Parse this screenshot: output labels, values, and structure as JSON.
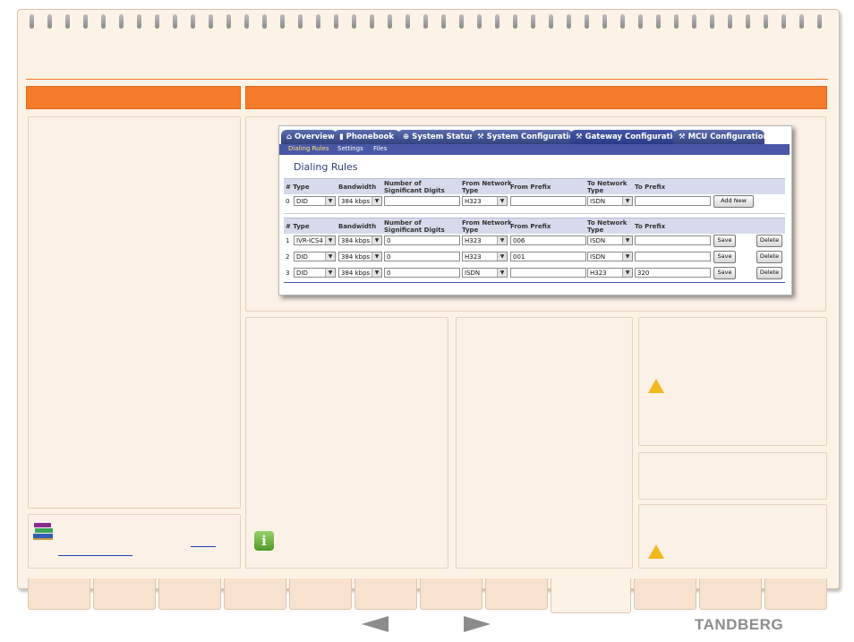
{
  "screenshot": {
    "tabs": [
      {
        "label": "Overview",
        "icon": "home-icon"
      },
      {
        "label": "Phonebook",
        "icon": "book-icon"
      },
      {
        "label": "System Status",
        "icon": "status-icon"
      },
      {
        "label": "System Configuration",
        "icon": "wrench-icon"
      },
      {
        "label": "Gateway Configuration",
        "icon": "wrench-icon"
      },
      {
        "label": "MCU Configuration",
        "icon": "wrench-icon"
      }
    ],
    "subtabs": [
      "Dialing Rules",
      "Settings",
      "Files"
    ],
    "title": "Dialing Rules",
    "headers": {
      "num_type": "# Type",
      "bandwidth": "Bandwidth",
      "sig_digits": "Number of Significant Digits",
      "from_net": "From Network Type",
      "from_prefix": "From Prefix",
      "to_net": "To Network Type",
      "to_prefix": "To Prefix"
    },
    "new_row": {
      "num": "0",
      "type": "DID",
      "bandwidth": "384 kbps",
      "digits": "",
      "from_net": "H323",
      "from_prefix": "",
      "to_net": "ISDN",
      "to_prefix": "",
      "button": "Add New"
    },
    "rows": [
      {
        "num": "1",
        "type": "IVR-ICS4",
        "bandwidth": "384 kbps",
        "digits": "0",
        "from_net": "H323",
        "from_prefix": "006",
        "to_net": "ISDN",
        "to_prefix": "",
        "save": "Save",
        "delete": "Delete"
      },
      {
        "num": "2",
        "type": "DID",
        "bandwidth": "384 kbps",
        "digits": "0",
        "from_net": "H323",
        "from_prefix": "001",
        "to_net": "ISDN",
        "to_prefix": "",
        "save": "Save",
        "delete": "Delete"
      },
      {
        "num": "3",
        "type": "DID",
        "bandwidth": "384 kbps",
        "digits": "0",
        "from_net": "ISDN",
        "from_prefix": "",
        "to_net": "H323",
        "to_prefix": "320",
        "save": "Save",
        "delete": "Delete"
      }
    ]
  },
  "footer": {
    "logo": "TANDBERG"
  },
  "colors": {
    "accent": "#f47b2a",
    "tab_blue": "#3a4a94",
    "warning": "#f2b81c",
    "info": "#5aa832"
  }
}
